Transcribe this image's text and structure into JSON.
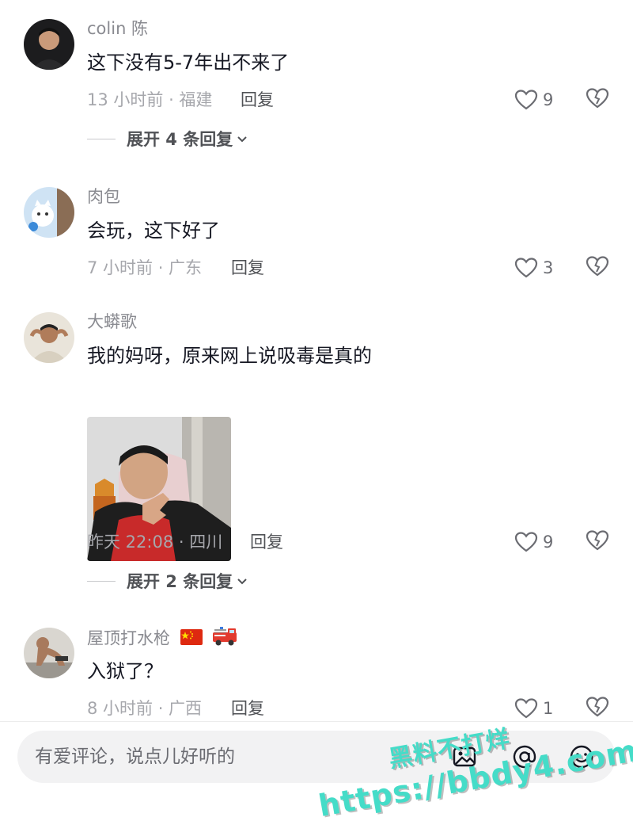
{
  "comments": [
    {
      "username": "colin 陈",
      "text": "这下没有5-7年出不来了",
      "meta": "13 小时前 · 福建",
      "reply_label": "回复",
      "likes": "9",
      "expand_label": "展开 4 条回复"
    },
    {
      "username": "肉包",
      "text": "会玩，这下好了",
      "meta": "7 小时前 · 广东",
      "reply_label": "回复",
      "likes": "3"
    },
    {
      "username": "大蟒歌",
      "text": "我的妈呀，原来网上说吸毒是真的",
      "meta": "昨天 22:08 · 四川",
      "reply_label": "回复",
      "likes": "9",
      "expand_label": "展开 2 条回复"
    },
    {
      "username": "屋顶打水枪",
      "text": "入狱了？",
      "meta": "8 小时前 · 广西",
      "reply_label": "回复",
      "likes": "1"
    }
  ],
  "input": {
    "placeholder": "有爱评论，说点儿好听的"
  },
  "watermark": {
    "line1": "黑料不打烊",
    "line2": "https://bbdy4.com"
  },
  "colors": {
    "primary_text": "#161823",
    "secondary_text": "#8a8b91",
    "watermark": "#45dcc8"
  },
  "icons": [
    "heart-outline-icon",
    "broken-heart-icon",
    "chevron-down-icon",
    "image-icon",
    "at-icon",
    "emoji-icon",
    "china-flag-icon",
    "fire-truck-icon"
  ]
}
